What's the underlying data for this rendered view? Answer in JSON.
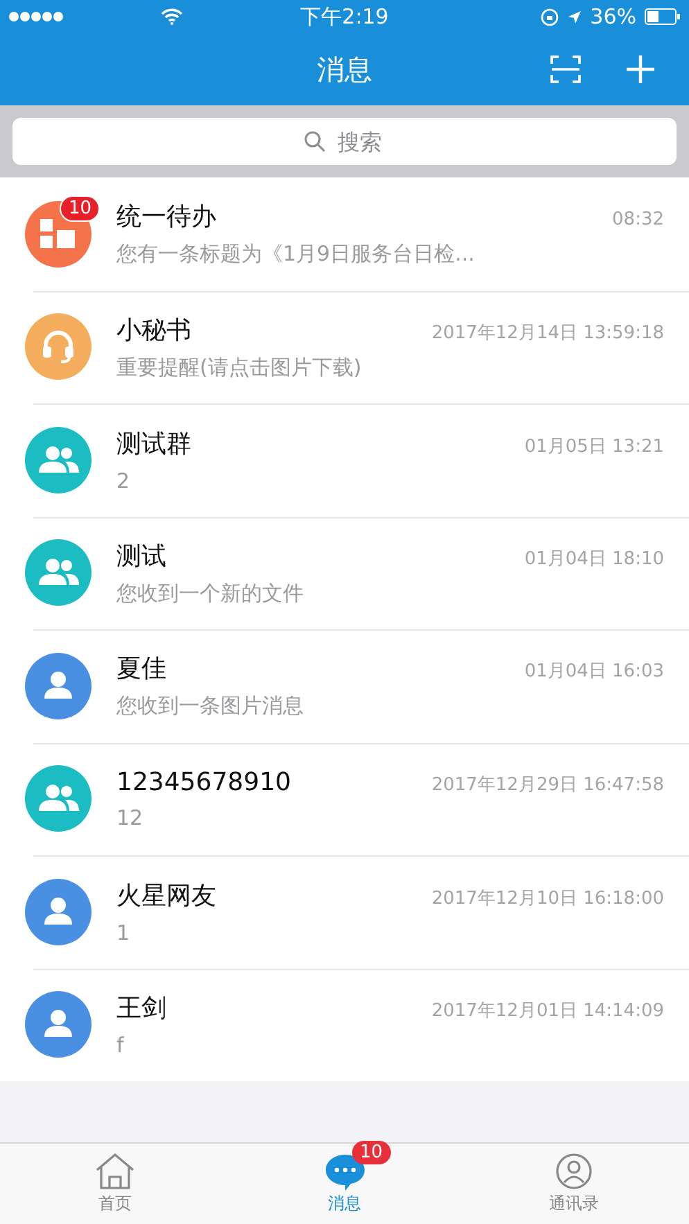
{
  "status_bar": {
    "time": "下午2:19",
    "battery": "36%"
  },
  "nav": {
    "title": "消息"
  },
  "search": {
    "placeholder": "搜索"
  },
  "conversations": [
    {
      "kind": "todo",
      "badge": "10",
      "name": "统一待办",
      "time": "08:32",
      "preview": "您有一条标题为《1月9日服务台日检..."
    },
    {
      "kind": "assistant",
      "name": "小秘书",
      "time": "2017年12月14日 13:59:18",
      "preview": "重要提醒(请点击图片下载)"
    },
    {
      "kind": "group",
      "name": "测试群",
      "time": "01月05日 13:21",
      "preview": "2"
    },
    {
      "kind": "group",
      "name": "测试",
      "time": "01月04日 18:10",
      "preview": "您收到一个新的文件"
    },
    {
      "kind": "person",
      "name": "夏佳",
      "time": "01月04日 16:03",
      "preview": "您收到一条图片消息"
    },
    {
      "kind": "group",
      "name": "12345678910",
      "time": "2017年12月29日 16:47:58",
      "preview": "12"
    },
    {
      "kind": "person",
      "name": "火星网友",
      "time": "2017年12月10日 16:18:00",
      "preview": "1"
    },
    {
      "kind": "person",
      "name": "王剑",
      "time": "2017年12月01日 14:14:09",
      "preview": "f"
    }
  ],
  "tabs": [
    {
      "kind": "home",
      "label": "首页",
      "selected": false
    },
    {
      "kind": "chat",
      "label": "消息",
      "selected": true,
      "badge": "10"
    },
    {
      "kind": "contacts",
      "label": "通讯录",
      "selected": false
    }
  ]
}
